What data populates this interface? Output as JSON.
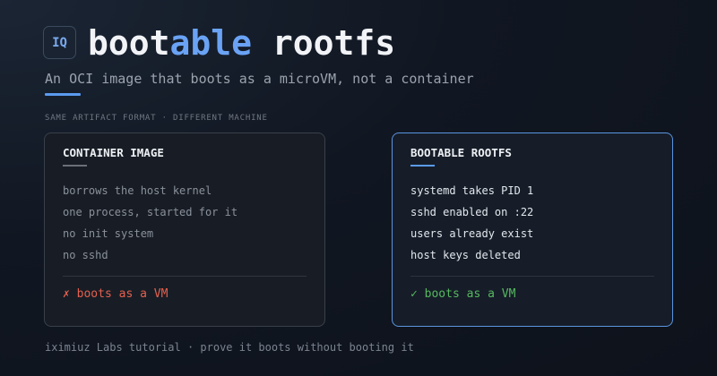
{
  "logo": {
    "text": "IQ"
  },
  "header": {
    "title_part1": "boot",
    "title_part2": "able",
    "title_part3": " rootfs",
    "subtitle": "An OCI image that boots as a microVM, not a container"
  },
  "kicker": "SAME ARTIFACT FORMAT · DIFFERENT MACHINE",
  "cards": [
    {
      "title": "CONTAINER IMAGE",
      "items": [
        "borrows the host kernel",
        "one process, started for it",
        "no init system",
        "no sshd"
      ],
      "verdict": "✗ boots as a VM",
      "verdict_color": "#e5604f"
    },
    {
      "title": "BOOTABLE ROOTFS",
      "items": [
        "systemd takes PID 1",
        "sshd enabled on :22",
        "users already exist",
        "host keys deleted"
      ],
      "verdict": "✓ boots as a VM",
      "verdict_color": "#57b860"
    }
  ],
  "footer": "iximiuz Labs tutorial · prove it boots without booting it",
  "colors": {
    "accent": "#5b9bf0",
    "background": "#111722",
    "fail": "#e5604f",
    "success": "#57b860"
  }
}
